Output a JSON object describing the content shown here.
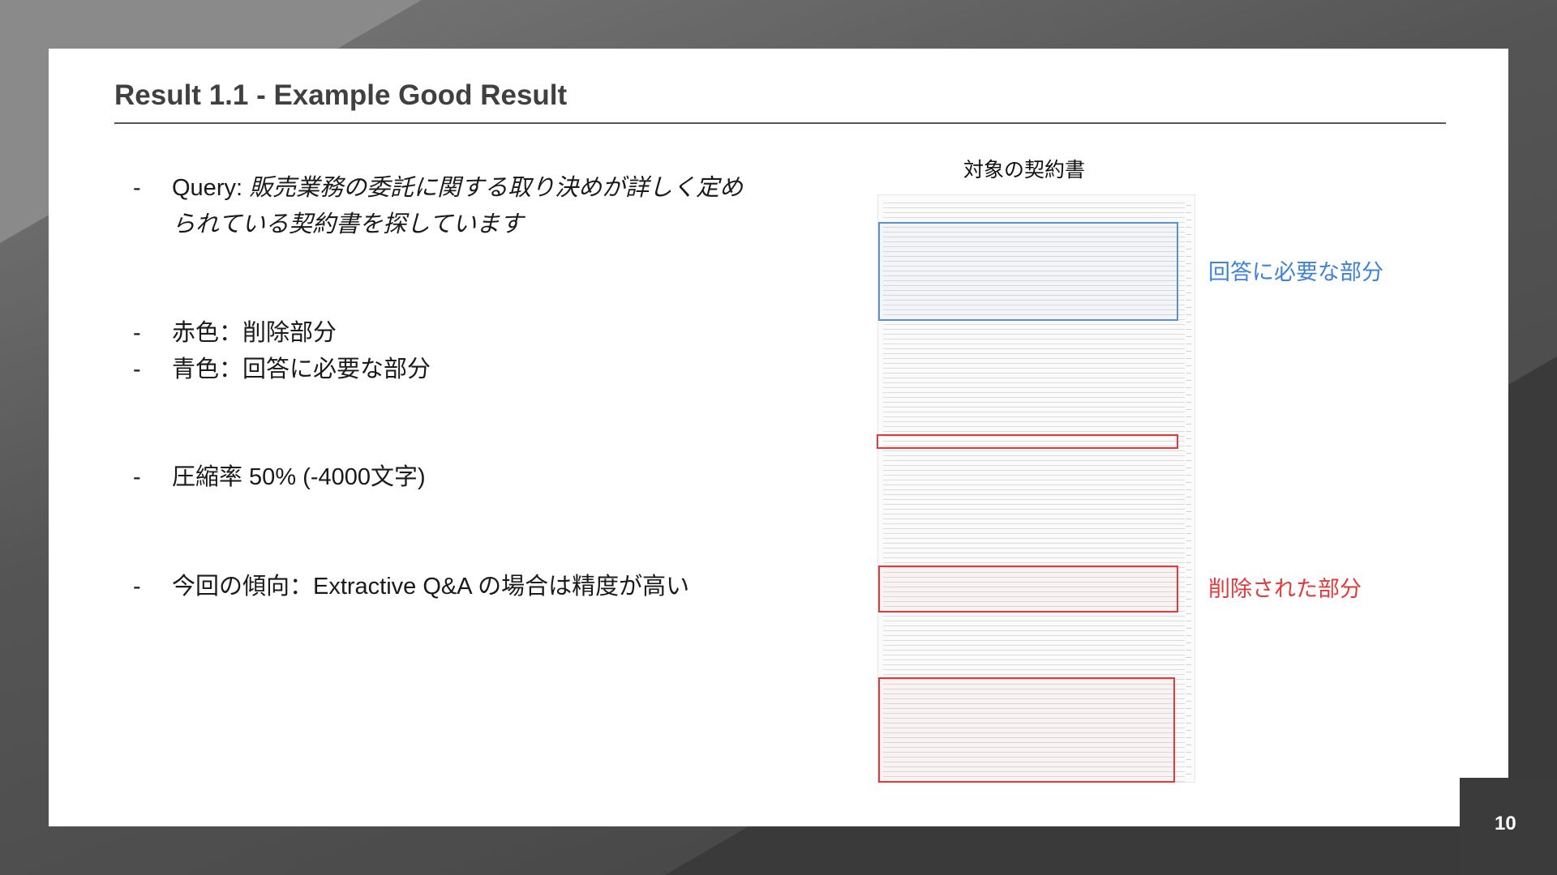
{
  "slide": {
    "title": "Result 1.1 - Example Good Result",
    "page_number": "10"
  },
  "bullets": [
    {
      "dash": "-",
      "prefix": "Query: ",
      "text_line1": "販売業務の委託に関する取り決めが詳しく定め",
      "text_line2": "られている契約書を探しています"
    },
    {
      "dash": "-",
      "text": "赤色：削除部分"
    },
    {
      "dash": "-",
      "text": "青色：回答に必要な部分"
    },
    {
      "dash": "-",
      "text": "圧縮率 50% (-4000文字)"
    },
    {
      "dash": "-",
      "text": "今回の傾向：Extractive Q&A の場合は精度が高い"
    }
  ],
  "document_preview": {
    "caption": "対象の契約書",
    "label_required": "回答に必要な部分",
    "label_removed": "削除された部分"
  },
  "colors": {
    "required_highlight": "#3f82d6",
    "removed_highlight": "#e03a3a"
  }
}
